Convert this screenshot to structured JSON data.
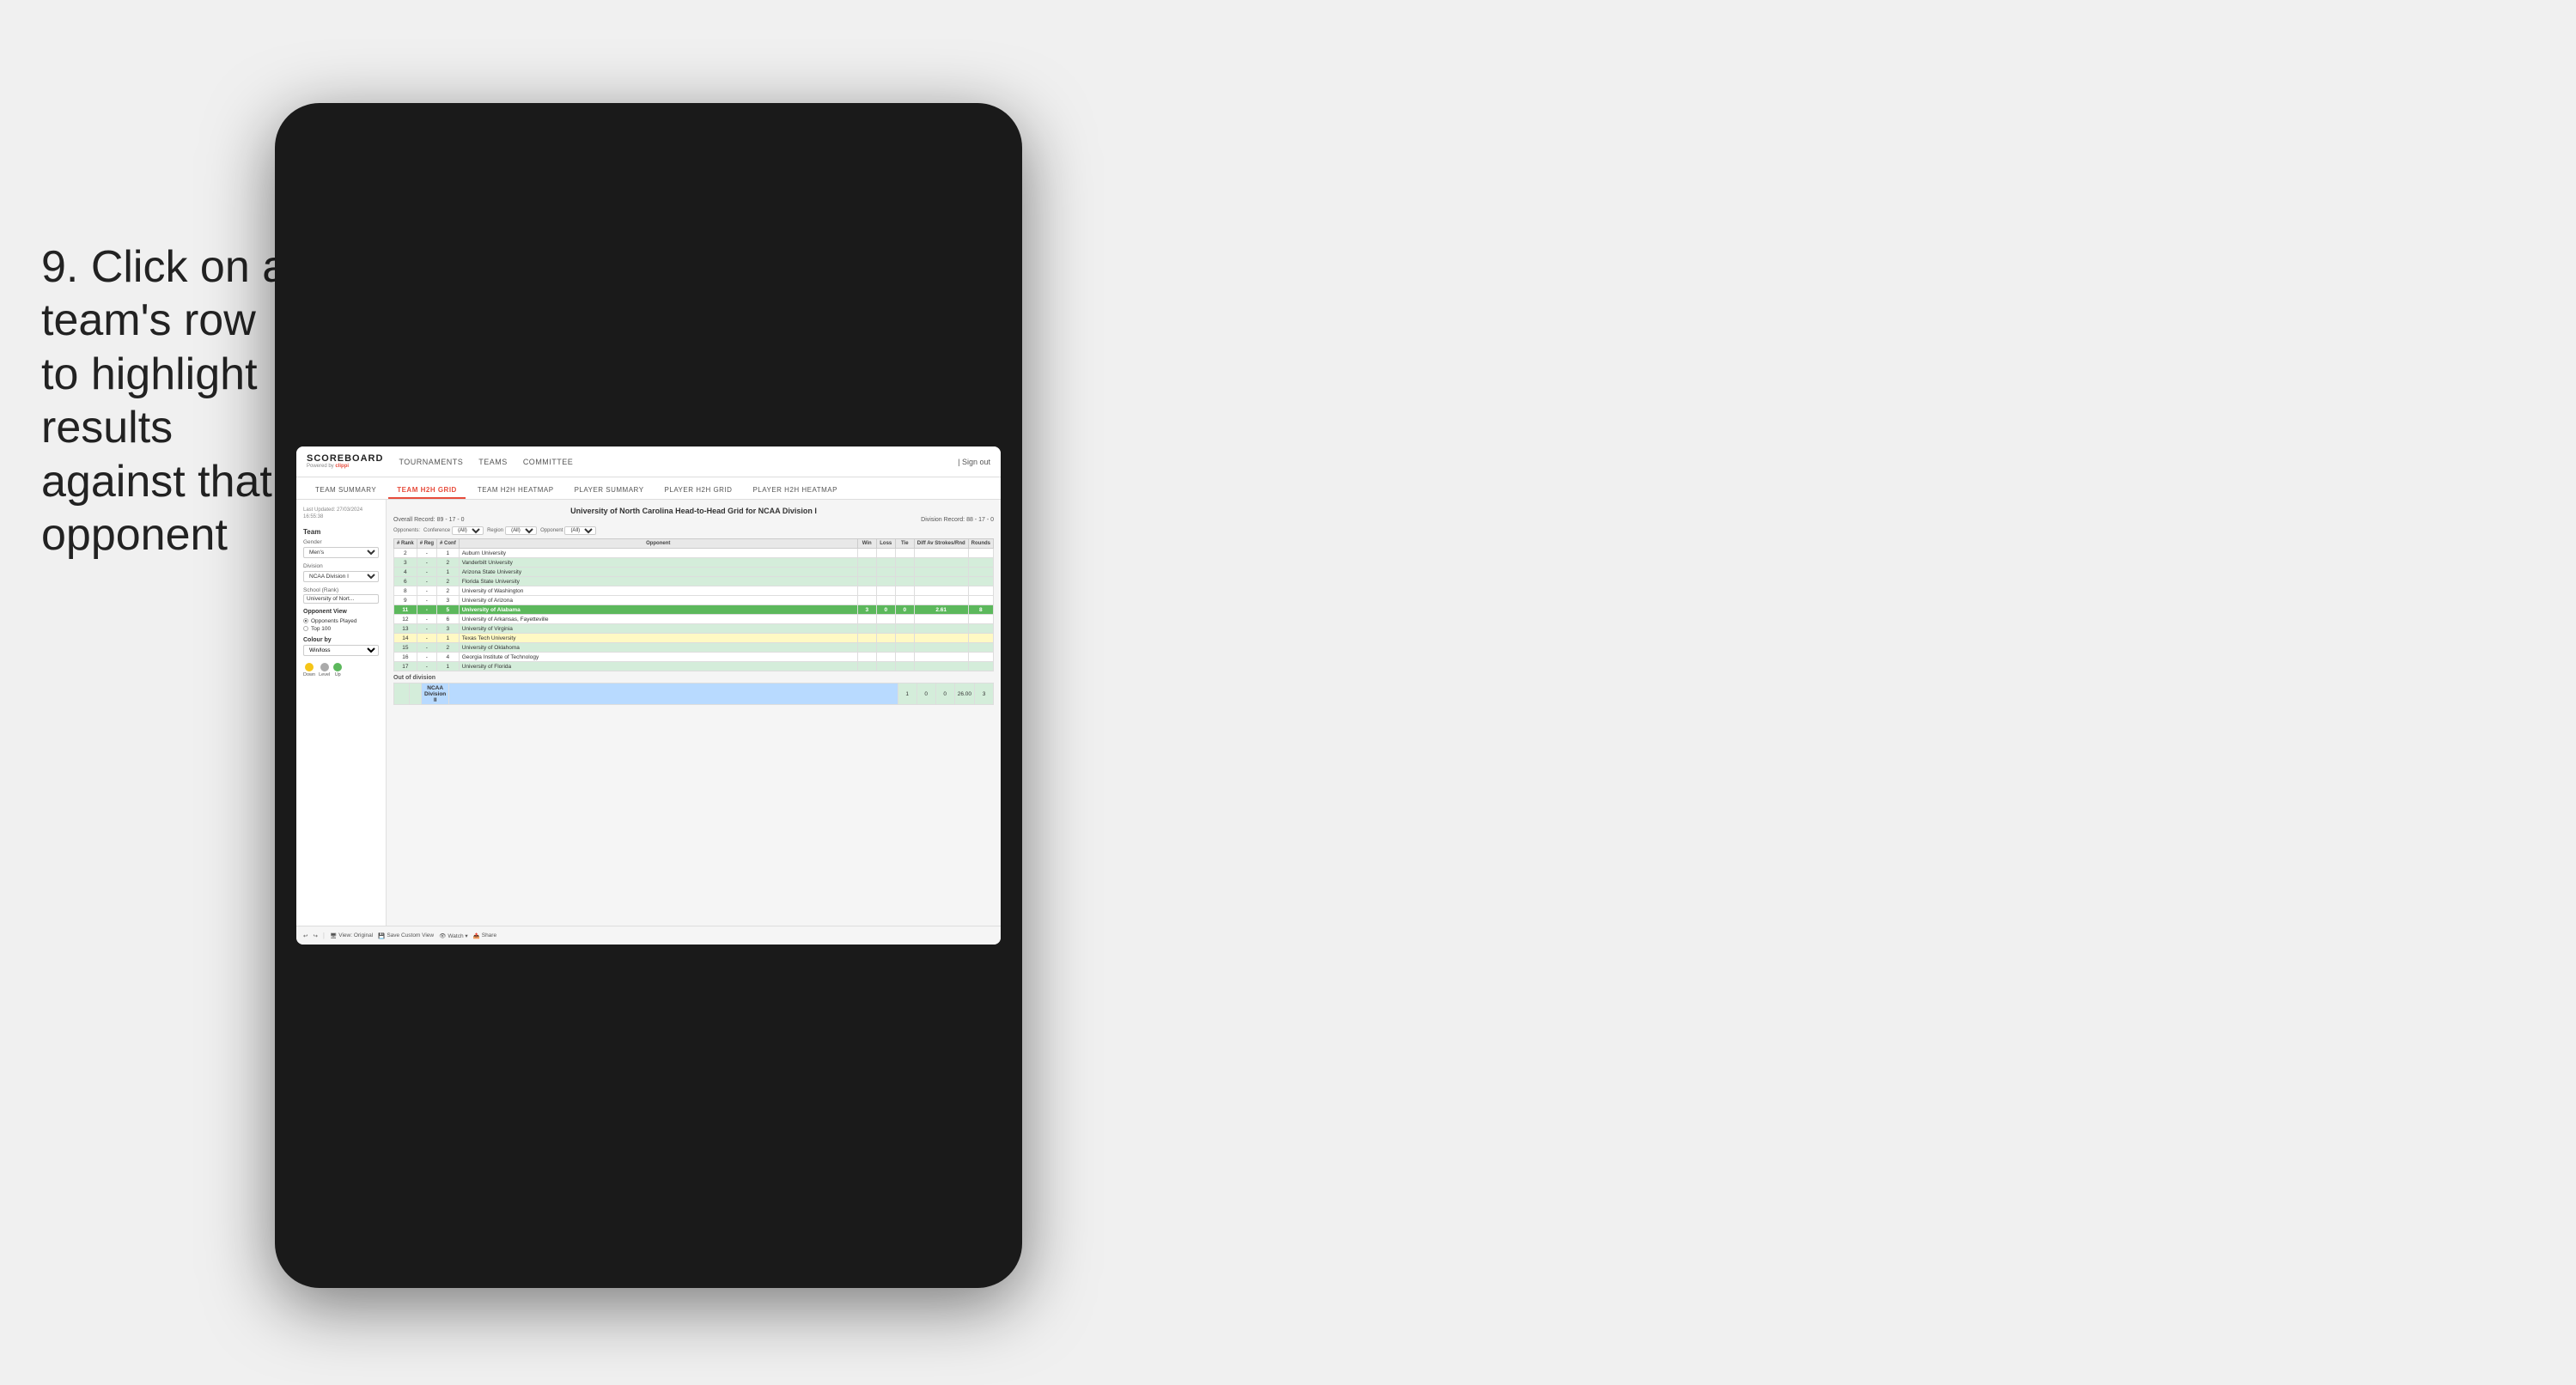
{
  "instruction": {
    "step": "9.",
    "text": "Click on a team's row to highlight results against that opponent"
  },
  "app": {
    "logo": "SCOREBOARD",
    "powered_by": "Powered by",
    "brand": "clippi",
    "nav": {
      "tournaments": "TOURNAMENTS",
      "teams": "TEAMS",
      "committee": "COMMITTEE",
      "sign_out": "Sign out"
    },
    "sub_tabs": [
      {
        "label": "TEAM SUMMARY",
        "active": false
      },
      {
        "label": "TEAM H2H GRID",
        "active": true
      },
      {
        "label": "TEAM H2H HEATMAP",
        "active": false
      },
      {
        "label": "PLAYER SUMMARY",
        "active": false
      },
      {
        "label": "PLAYER H2H GRID",
        "active": false
      },
      {
        "label": "PLAYER H2H HEATMAP",
        "active": false
      }
    ]
  },
  "left_panel": {
    "last_updated_label": "Last Updated: 27/03/2024",
    "last_updated_time": "16:55:38",
    "team_label": "Team",
    "gender_label": "Gender",
    "gender_value": "Men's",
    "division_label": "Division",
    "division_value": "NCAA Division I",
    "school_rank_label": "School (Rank)",
    "school_rank_value": "University of Nort...",
    "opponent_view_label": "Opponent View",
    "opponents_played_label": "Opponents Played",
    "top100_label": "Top 100",
    "colour_by_label": "Colour by",
    "colour_by_value": "Win/loss",
    "legend": {
      "down_label": "Down",
      "down_color": "#f5c518",
      "level_label": "Level",
      "level_color": "#aaaaaa",
      "up_label": "Up",
      "up_color": "#5cb85c"
    }
  },
  "report": {
    "title": "University of North Carolina Head-to-Head Grid for NCAA Division I",
    "overall_record_label": "Overall Record:",
    "overall_record_value": "89 - 17 - 0",
    "division_record_label": "Division Record:",
    "division_record_value": "88 - 17 - 0",
    "filters": {
      "opponents_label": "Opponents:",
      "conference_label": "Conference",
      "conference_value": "(All)",
      "region_label": "Region",
      "region_value": "(All)",
      "opponent_label": "Opponent",
      "opponent_value": "(All)"
    },
    "table_headers": [
      "# Rank",
      "# Reg",
      "# Conf",
      "Opponent",
      "Win",
      "Loss",
      "Tie",
      "Diff Av Strokes/Rnd",
      "Rounds"
    ],
    "rows": [
      {
        "rank": "2",
        "reg": "-",
        "conf": "1",
        "opponent": "Auburn University",
        "win": "",
        "loss": "",
        "tie": "",
        "diff": "",
        "rounds": "",
        "style": "normal"
      },
      {
        "rank": "3",
        "reg": "-",
        "conf": "2",
        "opponent": "Vanderbilt University",
        "win": "",
        "loss": "",
        "tie": "",
        "diff": "",
        "rounds": "",
        "style": "light-green"
      },
      {
        "rank": "4",
        "reg": "-",
        "conf": "1",
        "opponent": "Arizona State University",
        "win": "",
        "loss": "",
        "tie": "",
        "diff": "",
        "rounds": "",
        "style": "light-green"
      },
      {
        "rank": "6",
        "reg": "-",
        "conf": "2",
        "opponent": "Florida State University",
        "win": "",
        "loss": "",
        "tie": "",
        "diff": "",
        "rounds": "",
        "style": "light-green"
      },
      {
        "rank": "8",
        "reg": "-",
        "conf": "2",
        "opponent": "University of Washington",
        "win": "",
        "loss": "",
        "tie": "",
        "diff": "",
        "rounds": "",
        "style": "normal"
      },
      {
        "rank": "9",
        "reg": "-",
        "conf": "3",
        "opponent": "University of Arizona",
        "win": "",
        "loss": "",
        "tie": "",
        "diff": "",
        "rounds": "",
        "style": "normal"
      },
      {
        "rank": "11",
        "reg": "-",
        "conf": "5",
        "opponent": "University of Alabama",
        "win": "3",
        "loss": "0",
        "tie": "0",
        "diff": "2.61",
        "rounds": "8",
        "style": "highlighted"
      },
      {
        "rank": "12",
        "reg": "-",
        "conf": "6",
        "opponent": "University of Arkansas, Fayetteville",
        "win": "",
        "loss": "",
        "tie": "",
        "diff": "",
        "rounds": "",
        "style": "normal"
      },
      {
        "rank": "13",
        "reg": "-",
        "conf": "3",
        "opponent": "University of Virginia",
        "win": "",
        "loss": "",
        "tie": "",
        "diff": "",
        "rounds": "",
        "style": "light-green"
      },
      {
        "rank": "14",
        "reg": "-",
        "conf": "1",
        "opponent": "Texas Tech University",
        "win": "",
        "loss": "",
        "tie": "",
        "diff": "",
        "rounds": "",
        "style": "light-yellow"
      },
      {
        "rank": "15",
        "reg": "-",
        "conf": "2",
        "opponent": "University of Oklahoma",
        "win": "",
        "loss": "",
        "tie": "",
        "diff": "",
        "rounds": "",
        "style": "light-green"
      },
      {
        "rank": "16",
        "reg": "-",
        "conf": "4",
        "opponent": "Georgia Institute of Technology",
        "win": "",
        "loss": "",
        "tie": "",
        "diff": "",
        "rounds": "",
        "style": "normal"
      },
      {
        "rank": "17",
        "reg": "-",
        "conf": "1",
        "opponent": "University of Florida",
        "win": "",
        "loss": "",
        "tie": "",
        "diff": "",
        "rounds": "",
        "style": "light-green"
      }
    ],
    "out_of_division": {
      "label": "Out of division",
      "row": {
        "label": "NCAA Division II",
        "win": "1",
        "loss": "0",
        "tie": "0",
        "diff": "26.00",
        "rounds": "3"
      }
    }
  },
  "toolbar": {
    "undo": "↩",
    "redo": "↪",
    "view_original": "View: Original",
    "save_custom": "Save Custom View",
    "watch": "Watch ▾",
    "share": "Share"
  }
}
